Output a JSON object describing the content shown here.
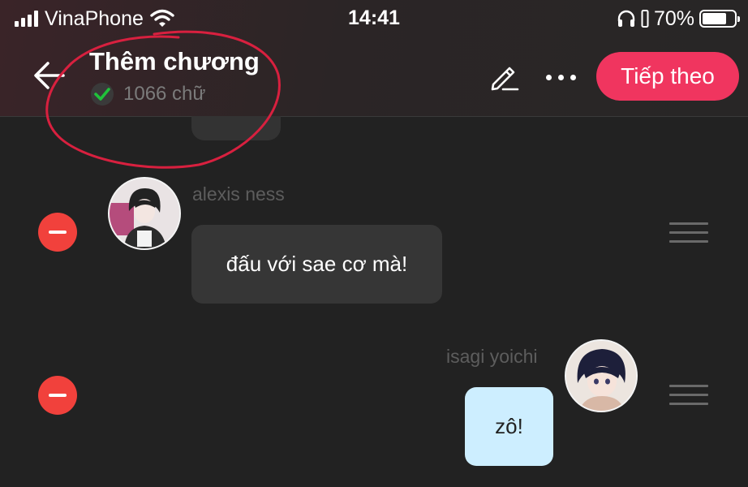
{
  "status_bar": {
    "carrier": "VinaPhone",
    "time": "14:41",
    "battery": "70%",
    "battery_level": 0.7
  },
  "header": {
    "title": "Thêm chương",
    "word_count": "1066 chữ",
    "next_label": "Tiếp theo"
  },
  "colors": {
    "accent": "#f0355f",
    "remove": "#f1413c",
    "check": "#1fc23a",
    "annotation": "#d8203f",
    "incoming_bubble": "#363636",
    "outgoing_bubble": "#cdeeff"
  },
  "messages": [
    {
      "sender": "alexis ness",
      "text": "đấu với sae cơ mà!",
      "side": "left"
    },
    {
      "sender": "isagi yoichi",
      "text": "zô!",
      "side": "right"
    }
  ]
}
